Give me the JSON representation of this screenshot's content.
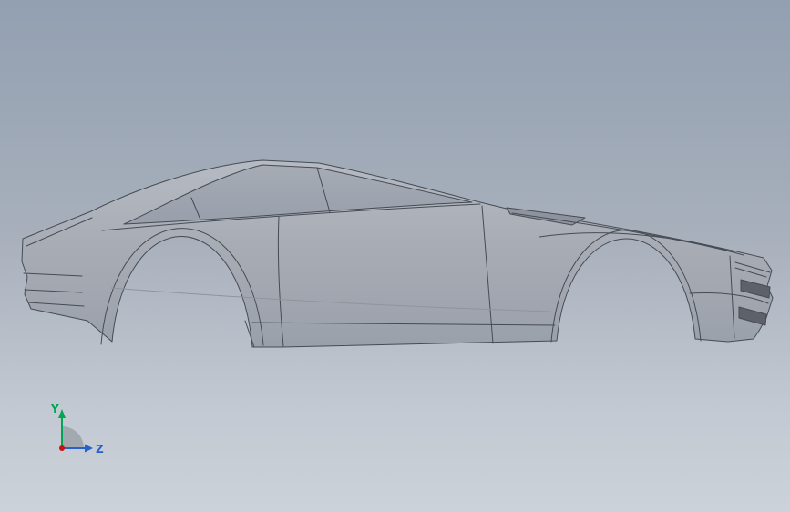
{
  "viewport": {
    "type": "3d-cad-viewport",
    "background_top": "#92a0b1",
    "background_mid": "#a7afbb",
    "background_bottom": "#ccd2d9"
  },
  "model": {
    "label": "car-body-side-profile",
    "edge_color": "#464b54",
    "body_fill_top": "#b6bac2",
    "body_fill_mid": "#a8acb5",
    "body_fill_bottom": "#9aa0aa",
    "glass_fill_top": "#a6abb4",
    "glass_fill_bottom": "#989fab",
    "slot_fill": "#5d616a",
    "cowl_fill": "#8e939d",
    "highlight_line": "#8f949d"
  },
  "triad": {
    "y_label": "Y",
    "z_label": "Z",
    "y_color": "#00a651",
    "z_color": "#2661cc",
    "x_color": "#cc1111",
    "hub_color": "#99a0a8"
  }
}
